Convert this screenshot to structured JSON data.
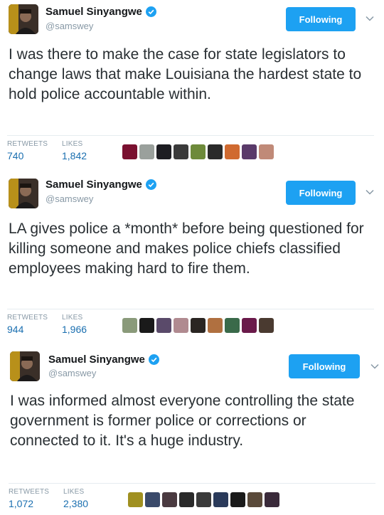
{
  "tweets": [
    {
      "author_name": "Samuel Sinyangwe",
      "handle": "@samswey",
      "follow_label": "Following",
      "text": "I was there to make the case for state legislators to change laws that make Louisiana the hardest state to hold police accountable within.",
      "retweets_label": "RETWEETS",
      "retweets": "740",
      "likes_label": "LIKES",
      "likes": "1,842",
      "likers": [
        "#7a1030",
        "#9aa09c",
        "#1d1d22",
        "#3a3a3a",
        "#6d8a3a",
        "#2a2a2a",
        "#d06a30",
        "#5a3a6a",
        "#c08a78"
      ]
    },
    {
      "author_name": "Samuel Sinyangwe",
      "handle": "@samswey",
      "follow_label": "Following",
      "text": "LA gives police a *month* before being questioned for killing someone and makes police chiefs classified employees making hard to fire them.",
      "retweets_label": "RETWEETS",
      "retweets": "944",
      "likes_label": "LIKES",
      "likes": "1,966",
      "likers": [
        "#8a9a7a",
        "#1a1a1a",
        "#5a4a6a",
        "#b08a90",
        "#2a2522",
        "#b07040",
        "#3a6a4a",
        "#6a1a4a",
        "#4a3a30"
      ]
    },
    {
      "author_name": "Samuel Sinyangwe",
      "handle": "@samswey",
      "follow_label": "Following",
      "text": "I was informed almost everyone controlling the state government is former police or corrections or connected to it. It's a huge industry.",
      "retweets_label": "RETWEETS",
      "retweets": "1,072",
      "likes_label": "LIKES",
      "likes": "2,380",
      "likers": [
        "#a09020",
        "#3a4a6a",
        "#4a3a40",
        "#2a2a2a",
        "#3a3a3a",
        "#2a3a5a",
        "#1a1a1a",
        "#5a4a3a",
        "#3a2a3a"
      ]
    }
  ],
  "colors": {
    "follow_button": "#1da1f2",
    "stat_value": "#1a6fb0",
    "verified_badge": "#1da1f2"
  }
}
